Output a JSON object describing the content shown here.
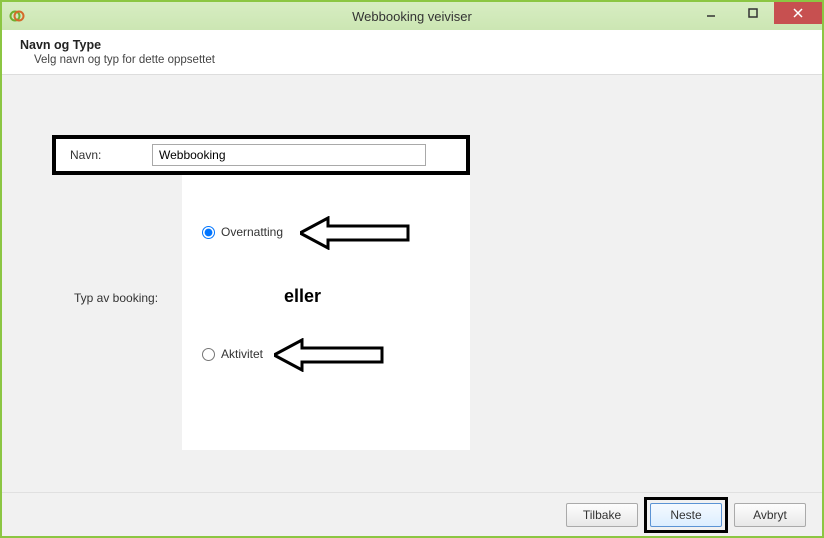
{
  "window": {
    "title": "Webbooking veiviser"
  },
  "header": {
    "title": "Navn og Type",
    "subtitle": "Velg navn og typ for dette oppsettet"
  },
  "form": {
    "name_label": "Navn:",
    "name_value": "Webbooking",
    "type_label": "Typ av booking:",
    "option_overnight": "Overnatting",
    "option_activity": "Aktivitet",
    "or_text": "eller",
    "selected_option": "overnight"
  },
  "footer": {
    "back": "Tilbake",
    "next": "Neste",
    "cancel": "Avbryt"
  }
}
